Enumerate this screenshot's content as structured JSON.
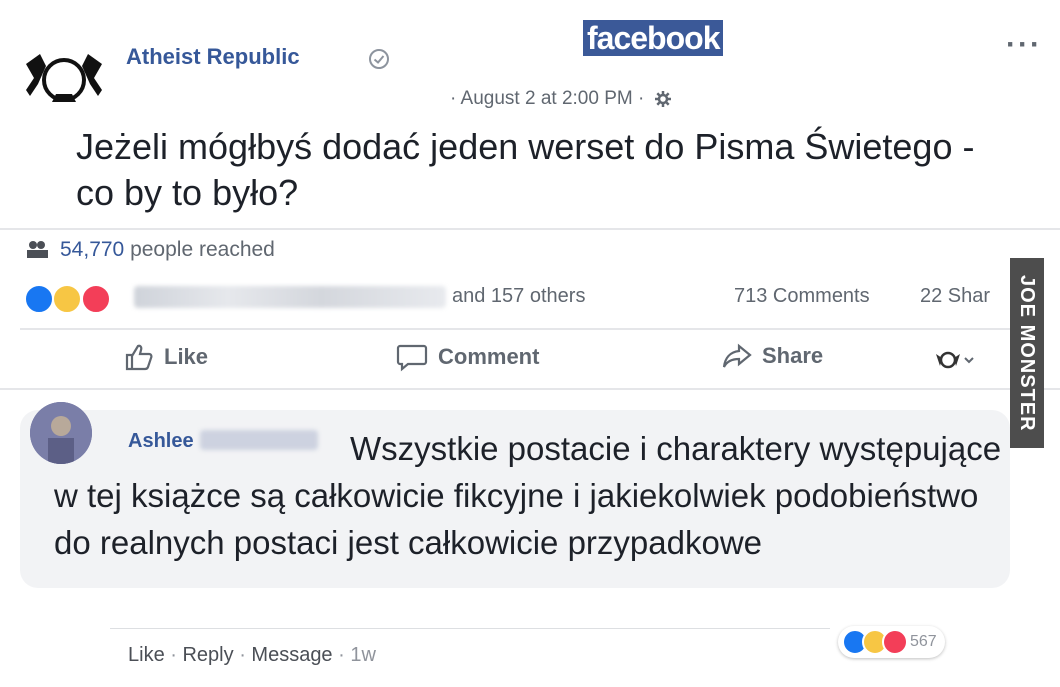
{
  "header": {
    "brand": "facebook",
    "page_name": "Atheist Republic",
    "timestamp": "· August 2 at 2:00 PM ·",
    "more": "···"
  },
  "post": {
    "text": "Jeżeli mógłbyś dodać jeden werset do Pisma Świetego - co by to było?"
  },
  "stats": {
    "reach_number": "54,770",
    "reach_suffix": " people reached",
    "reactions_others": "and 157 others",
    "comments": "713 Comments",
    "shares": "22 Shar"
  },
  "actions": {
    "like": "Like",
    "comment": "Comment",
    "share": "Share"
  },
  "watermark": "JOE MONSTER",
  "comment": {
    "author": "Ashlee",
    "text": "Wszystkie postacie i charaktery występujące w tej książce są całkowicie fikcyjne i jakiekolwiek podobieństwo do realnych postaci jest całkowicie przypadkowe",
    "like": "Like",
    "reply": "Reply",
    "message": "Message",
    "age": "1w",
    "reaction_count": "567"
  },
  "colors": {
    "brand": "#3b5998",
    "link": "#365899",
    "like_blue": "#1877f2",
    "haha_yellow": "#f7c644",
    "love_red": "#f33e58"
  }
}
